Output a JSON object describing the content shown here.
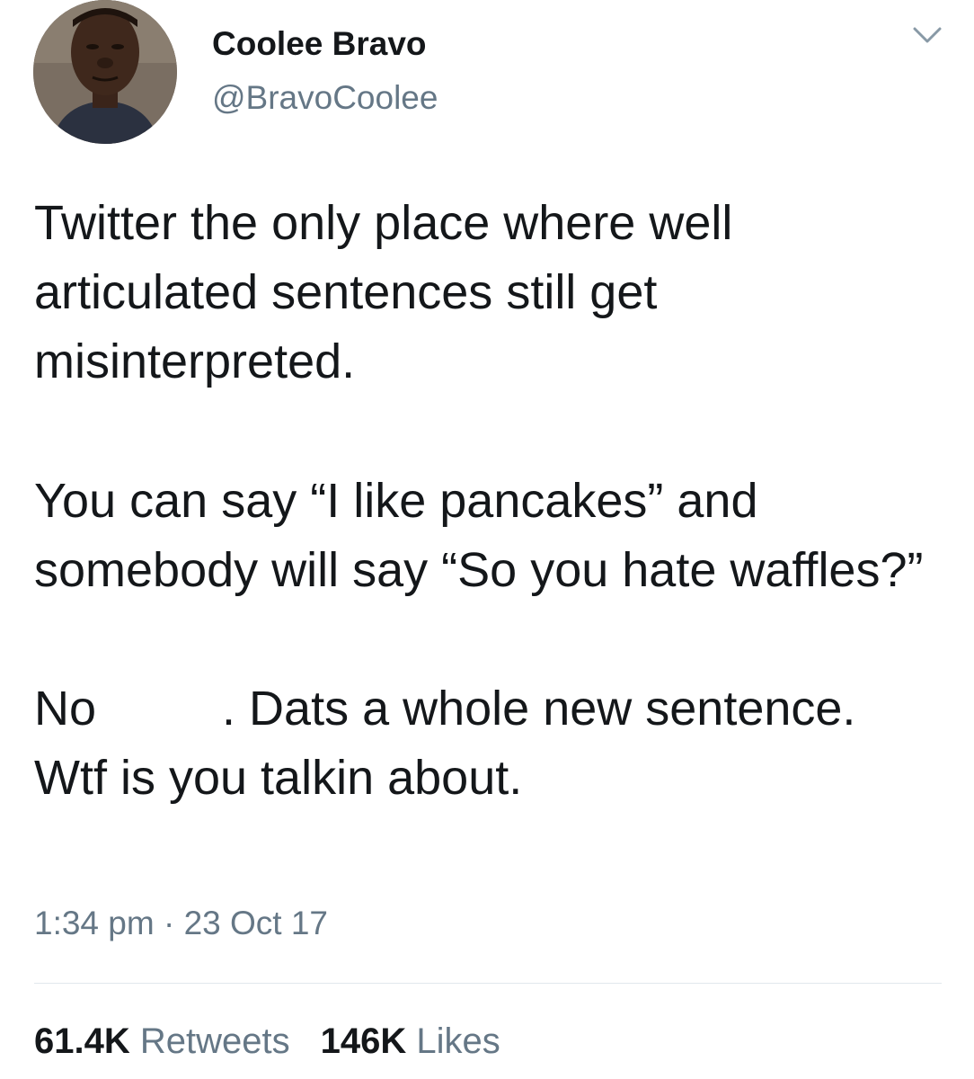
{
  "user": {
    "display_name": "Coolee Bravo",
    "handle": "@BravoCoolee"
  },
  "tweet": {
    "paragraph_1": "Twitter the only place where well articulated sentences still get misinterpreted.",
    "paragraph_2": "You can say “I like pancakes” and somebody will say “So you hate waffles?”",
    "paragraph_3_start": "No",
    "paragraph_3_end": ". Dats a whole new sentence. Wtf is you talkin about."
  },
  "timestamp": "1:34 pm · 23 Oct 17",
  "stats": {
    "retweets_count": "61.4K",
    "retweets_label": "Retweets",
    "likes_count": "146K",
    "likes_label": "Likes"
  },
  "icons": {
    "menu": "chevron-down-icon"
  },
  "colors": {
    "text_primary": "#14171a",
    "text_secondary": "#657786",
    "divider": "#e1e8ed"
  }
}
